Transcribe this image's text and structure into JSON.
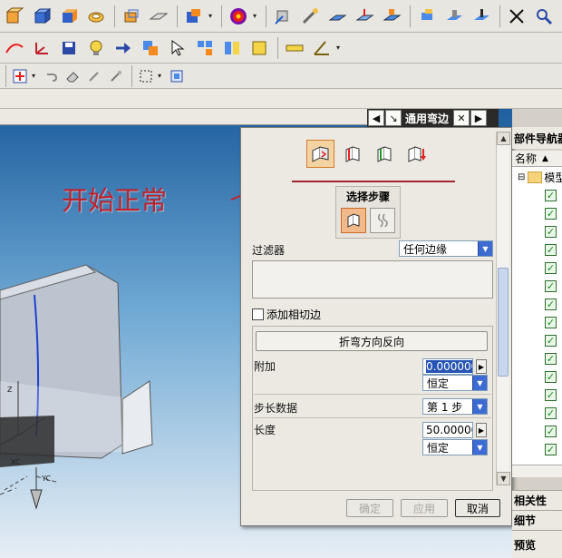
{
  "annotation": {
    "text": "开始正常"
  },
  "dialog": {
    "title": "通用弯边",
    "steps_title": "选择步骤",
    "filter_label": "过滤器",
    "filter_value": "任何边缘",
    "add_tangent_label": "添加相切边",
    "reverse_button": "折弯方向反向",
    "attach_label": "附加",
    "attach_value": "0.000000",
    "attach_mode": "恒定",
    "step_label": "步长数据",
    "step_value": "第 1 步",
    "length_label": "长度",
    "length_value": "50.000000",
    "length_mode": "恒定",
    "ok_label": "确定",
    "apply_label": "应用",
    "cancel_label": "取消"
  },
  "navigator": {
    "title": "部件导航器",
    "column_name": "名称",
    "root_label": "模型",
    "sections": [
      "相关性",
      "细节",
      "预览"
    ]
  },
  "colors": {
    "accent_red": "#c0202a",
    "selected_orange": "#f4d3a3",
    "combo_blue": "#3d6bd1"
  }
}
